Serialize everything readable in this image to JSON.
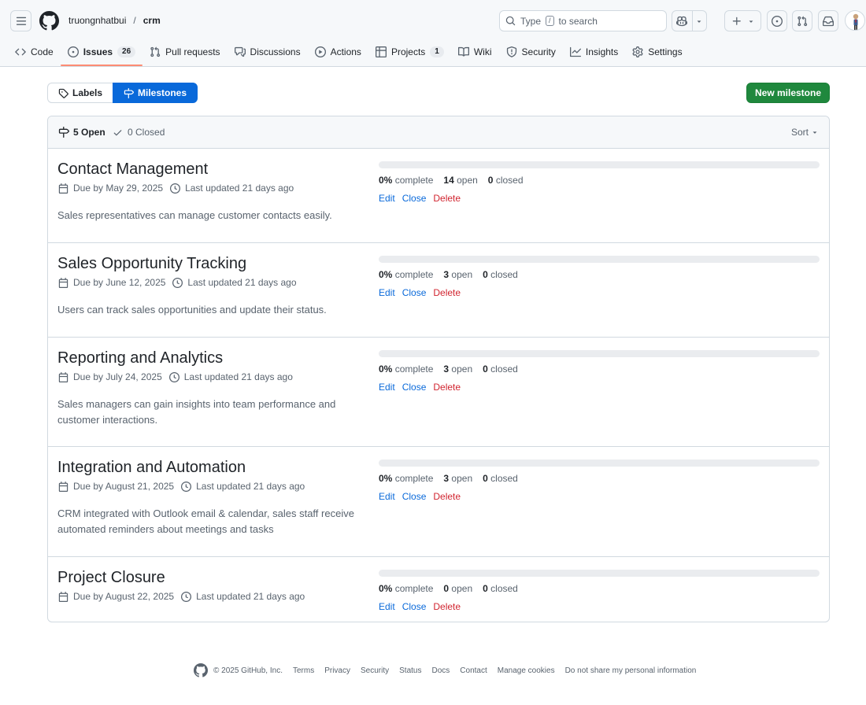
{
  "header": {
    "owner": "truongnhatbui",
    "separator": "/",
    "repo": "crm",
    "search": {
      "prefix": "Type",
      "key": "/",
      "suffix": "to search"
    }
  },
  "tabs": [
    {
      "label": "Code",
      "icon": "code-icon"
    },
    {
      "label": "Issues",
      "icon": "issue-opened-icon",
      "count": "26"
    },
    {
      "label": "Pull requests",
      "icon": "git-pull-request-icon"
    },
    {
      "label": "Discussions",
      "icon": "comment-discussion-icon"
    },
    {
      "label": "Actions",
      "icon": "play-icon"
    },
    {
      "label": "Projects",
      "icon": "table-icon",
      "count": "1"
    },
    {
      "label": "Wiki",
      "icon": "book-icon"
    },
    {
      "label": "Security",
      "icon": "shield-icon"
    },
    {
      "label": "Insights",
      "icon": "graph-icon"
    },
    {
      "label": "Settings",
      "icon": "gear-icon"
    }
  ],
  "subnav": {
    "labels": "Labels",
    "milestones": "Milestones",
    "new_milestone": "New milestone"
  },
  "list_header": {
    "open": "5 Open",
    "closed": "0 Closed",
    "sort": "Sort"
  },
  "milestones": [
    {
      "title": "Contact Management",
      "due": "Due by May 29, 2025",
      "updated": "Last updated 21 days ago",
      "description": "Sales representatives can manage customer contacts easily.",
      "progress": 0,
      "complete": "0%",
      "complete_label": "complete",
      "open": "14",
      "open_label": "open",
      "closed": "0",
      "closed_label": "closed"
    },
    {
      "title": "Sales Opportunity Tracking",
      "due": "Due by June 12, 2025",
      "updated": "Last updated 21 days ago",
      "description": "Users can track sales opportunities and update their status.",
      "progress": 0,
      "complete": "0%",
      "complete_label": "complete",
      "open": "3",
      "open_label": "open",
      "closed": "0",
      "closed_label": "closed"
    },
    {
      "title": "Reporting and Analytics",
      "due": "Due by July 24, 2025",
      "updated": "Last updated 21 days ago",
      "description": "Sales managers can gain insights into team performance and customer interactions.",
      "progress": 0,
      "complete": "0%",
      "complete_label": "complete",
      "open": "3",
      "open_label": "open",
      "closed": "0",
      "closed_label": "closed"
    },
    {
      "title": "Integration and Automation",
      "due": "Due by August 21, 2025",
      "updated": "Last updated 21 days ago",
      "description": "CRM integrated with Outlook email & calendar, sales staff receive automated reminders about meetings and tasks",
      "progress": 0,
      "complete": "0%",
      "complete_label": "complete",
      "open": "3",
      "open_label": "open",
      "closed": "0",
      "closed_label": "closed"
    },
    {
      "title": "Project Closure",
      "due": "Due by August 22, 2025",
      "updated": "Last updated 21 days ago",
      "description": "",
      "progress": 0,
      "complete": "0%",
      "complete_label": "complete",
      "open": "0",
      "open_label": "open",
      "closed": "0",
      "closed_label": "closed"
    }
  ],
  "milestone_actions": {
    "edit": "Edit",
    "close": "Close",
    "delete": "Delete"
  },
  "footer": {
    "copyright": "© 2025 GitHub, Inc.",
    "links": [
      "Terms",
      "Privacy",
      "Security",
      "Status",
      "Docs",
      "Contact",
      "Manage cookies",
      "Do not share my personal information"
    ]
  },
  "colors": {
    "accent": "#0969da",
    "primary_button": "#1f883d",
    "danger": "#d1242f",
    "tab_underline": "#fd8c73"
  }
}
